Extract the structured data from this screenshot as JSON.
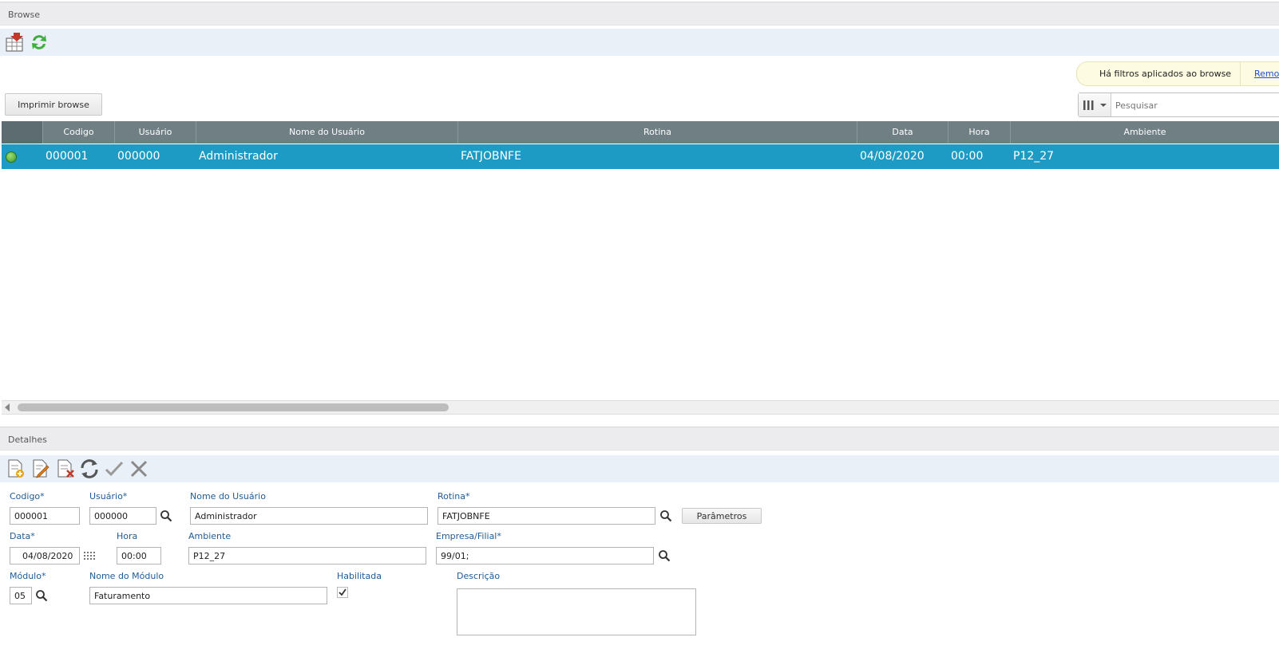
{
  "browse": {
    "title": "Browse",
    "filter_notice": "Há filtros aplicados ao browse",
    "filter_remove_link": "Remov",
    "print_button": "Imprimir browse",
    "search_placeholder": "Pesquisar",
    "columns": [
      "Codigo",
      "Usuário",
      "Nome do Usuário",
      "Rotina",
      "Data",
      "Hora",
      "Ambiente"
    ],
    "rows": [
      {
        "codigo": "000001",
        "usuario": "000000",
        "nome": "Administrador",
        "rotina": "FATJOBNFE",
        "data": "04/08/2020",
        "hora": "00:00",
        "ambiente": "P12_27",
        "status_color": "#3b9a22"
      }
    ]
  },
  "details": {
    "title": "Detalhes",
    "labels": {
      "codigo": "Codigo*",
      "usuario": "Usuário*",
      "nome_usuario": "Nome do Usuário",
      "rotina": "Rotina*",
      "data": "Data*",
      "hora": "Hora",
      "ambiente": "Ambiente",
      "empresa": "Empresa/Filial*",
      "modulo": "Módulo*",
      "nome_modulo": "Nome do Módulo",
      "habilitada": "Habilitada",
      "descricao": "Descrição"
    },
    "values": {
      "codigo": "000001",
      "usuario": "000000",
      "nome_usuario": "Administrador",
      "rotina": "FATJOBNFE",
      "data": "04/08/2020",
      "hora": "00:00",
      "ambiente": "P12_27",
      "empresa": "99/01;",
      "modulo": "05",
      "nome_modulo": "Faturamento",
      "descricao": ""
    },
    "parametros_button": "Parâmetros",
    "habilitada_checked": true
  },
  "colors": {
    "selected_row": "#1e9bc4",
    "grid_header": "#6f7f84",
    "label": "#1e5c9a"
  }
}
